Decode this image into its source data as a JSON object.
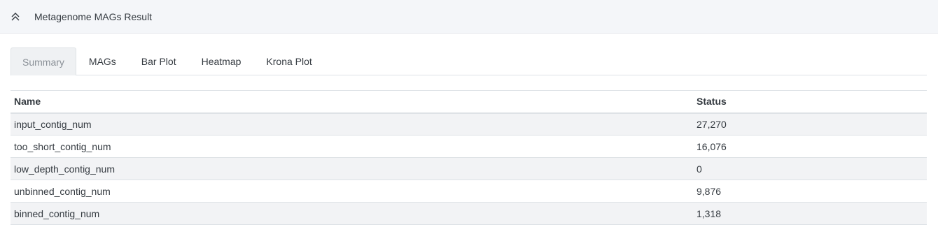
{
  "panel": {
    "title": "Metagenome MAGs Result",
    "collapse_icon": "chevron-double-up-icon"
  },
  "tabs": [
    {
      "label": "Summary",
      "active": true
    },
    {
      "label": "MAGs",
      "active": false
    },
    {
      "label": "Bar Plot",
      "active": false
    },
    {
      "label": "Heatmap",
      "active": false
    },
    {
      "label": "Krona Plot",
      "active": false
    }
  ],
  "table": {
    "headers": [
      "Name",
      "Status"
    ],
    "rows": [
      {
        "name": "input_contig_num",
        "status": "27,270"
      },
      {
        "name": "too_short_contig_num",
        "status": "16,076"
      },
      {
        "name": "low_depth_contig_num",
        "status": "0"
      },
      {
        "name": "unbinned_contig_num",
        "status": "9,876"
      },
      {
        "name": "binned_contig_num",
        "status": "1,318"
      }
    ]
  },
  "colors": {
    "header_bg": "#f4f6f9",
    "stripe_bg": "#f2f3f5",
    "active_tab_bg": "#eff1f3",
    "border": "#dee2e6"
  }
}
